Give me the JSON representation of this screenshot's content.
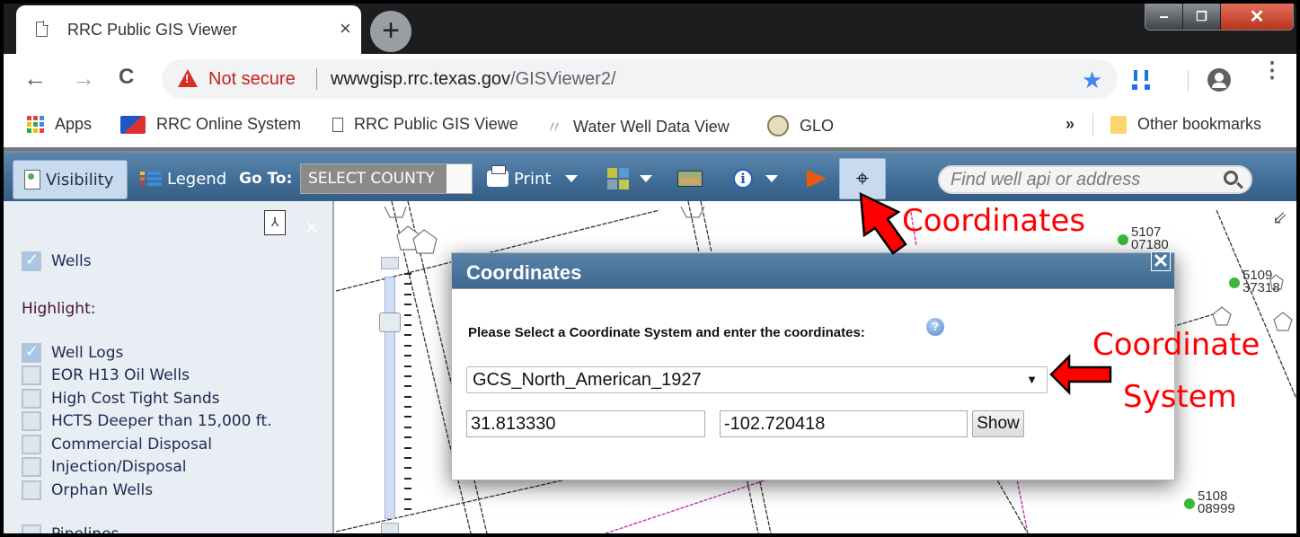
{
  "browser": {
    "tab_title": "RRC Public GIS Viewer",
    "tab_close": "×",
    "new_tab": "+",
    "window_controls": {
      "minimize": "–",
      "restore": "❐",
      "close": "✕"
    },
    "nav": {
      "back": "←",
      "forward": "→",
      "reload": "C"
    },
    "security_label": "Not secure",
    "url_host": "wwwgisp.rrc.texas.gov",
    "url_path": "/GISViewer2/",
    "bookmark_star": "★",
    "menu": "⋮",
    "bookmarks": [
      {
        "label": "Apps",
        "icon": "apps-grid-icon"
      },
      {
        "label": "RRC Online System",
        "icon": "rrc-logo-icon"
      },
      {
        "label": "RRC Public GIS Viewe",
        "icon": "document-icon"
      },
      {
        "label": "Water Well Data View",
        "icon": "feather-icon"
      },
      {
        "label": "GLO",
        "icon": "glo-seal-icon"
      }
    ],
    "overflow": "»",
    "other_bookmarks": "Other bookmarks"
  },
  "toolbar": {
    "visibility": "Visibility",
    "legend": "Legend",
    "goto_label": "Go To:",
    "county_select": "SELECT COUNTY",
    "print": "Print",
    "coordinates_icon": "⌖",
    "search_placeholder": "Find well api or address"
  },
  "panel": {
    "pdf_icon": "⅄",
    "close": "×",
    "wells": {
      "label": "Wells",
      "checked": true
    },
    "highlight_label": "Highlight:",
    "highlight_items": [
      {
        "label": "Well Logs",
        "checked": true
      },
      {
        "label": "EOR H13 Oil Wells",
        "checked": false
      },
      {
        "label": "High Cost Tight Sands",
        "checked": false
      },
      {
        "label": "HCTS Deeper than 15,000 ft.",
        "checked": false
      },
      {
        "label": "Commercial Disposal",
        "checked": false
      },
      {
        "label": "Injection/Disposal",
        "checked": false
      },
      {
        "label": "Orphan Wells",
        "checked": false
      }
    ],
    "next_section_partial": "Pipelines"
  },
  "map": {
    "expand_icon": "⇙",
    "wells": [
      {
        "line1": "5107",
        "line2": "07180"
      },
      {
        "line1": "5109",
        "line2": "37318"
      },
      {
        "line1": "5108",
        "line2": "08999"
      }
    ],
    "colors": {
      "well": "#3ab83a",
      "pipeline": "#cc33aa",
      "survey_line": "#333333"
    }
  },
  "dialog": {
    "title": "Coordinates",
    "close": "✕",
    "prompt": "Please Select a Coordinate System and enter the coordinates:",
    "help": "?",
    "coordinate_system": "GCS_North_American_1927",
    "select_arrow": "▼",
    "latitude": "31.813330",
    "longitude": "-102.720418",
    "show_button": "Show"
  },
  "annotations": {
    "coordinates": "Coordinates",
    "coordinate_system_line1": "Coordinate",
    "coordinate_system_line2": "System",
    "arrow_color": "#ff0000"
  }
}
